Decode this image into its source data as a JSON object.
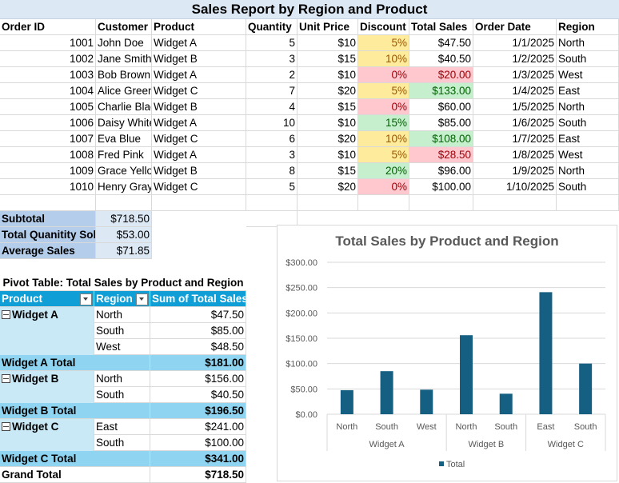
{
  "title": "Sales Report by Region and Product",
  "columns": [
    "Order ID",
    "Customer N",
    "Product",
    "Quantity",
    "Unit Price",
    "Discount",
    "Total Sales",
    "Order Date",
    "Region"
  ],
  "rows": [
    {
      "id": "1001",
      "customer": "John Doe",
      "product": "Widget A",
      "qty": "5",
      "price": "$10",
      "discount": "5%",
      "dclass": "yellow",
      "total": "$47.50",
      "tclass": "",
      "date": "1/1/2025",
      "region": "North"
    },
    {
      "id": "1002",
      "customer": "Jane Smith",
      "product": "Widget B",
      "qty": "3",
      "price": "$15",
      "discount": "10%",
      "dclass": "yellow",
      "total": "$40.50",
      "tclass": "",
      "date": "1/2/2025",
      "region": "South"
    },
    {
      "id": "1003",
      "customer": "Bob Brown",
      "product": "Widget A",
      "qty": "2",
      "price": "$10",
      "discount": "0%",
      "dclass": "red",
      "total": "$20.00",
      "tclass": "red",
      "date": "1/3/2025",
      "region": "West"
    },
    {
      "id": "1004",
      "customer": "Alice Green",
      "product": "Widget C",
      "qty": "7",
      "price": "$20",
      "discount": "5%",
      "dclass": "yellow",
      "total": "$133.00",
      "tclass": "green",
      "date": "1/4/2025",
      "region": "East"
    },
    {
      "id": "1005",
      "customer": "Charlie Blac",
      "product": "Widget B",
      "qty": "4",
      "price": "$15",
      "discount": "0%",
      "dclass": "red",
      "total": "$60.00",
      "tclass": "",
      "date": "1/5/2025",
      "region": "North"
    },
    {
      "id": "1006",
      "customer": "Daisy White",
      "product": "Widget A",
      "qty": "10",
      "price": "$10",
      "discount": "15%",
      "dclass": "green",
      "total": "$85.00",
      "tclass": "",
      "date": "1/6/2025",
      "region": "South"
    },
    {
      "id": "1007",
      "customer": "Eva Blue",
      "product": "Widget C",
      "qty": "6",
      "price": "$20",
      "discount": "10%",
      "dclass": "yellow",
      "total": "$108.00",
      "tclass": "green",
      "date": "1/7/2025",
      "region": "East"
    },
    {
      "id": "1008",
      "customer": "Fred Pink",
      "product": "Widget A",
      "qty": "3",
      "price": "$10",
      "discount": "5%",
      "dclass": "yellow",
      "total": "$28.50",
      "tclass": "red",
      "date": "1/8/2025",
      "region": "West"
    },
    {
      "id": "1009",
      "customer": "Grace Yello",
      "product": "Widget B",
      "qty": "8",
      "price": "$15",
      "discount": "20%",
      "dclass": "green",
      "total": "$96.00",
      "tclass": "",
      "date": "1/9/2025",
      "region": "North"
    },
    {
      "id": "1010",
      "customer": "Henry Gray",
      "product": "Widget C",
      "qty": "5",
      "price": "$20",
      "discount": "0%",
      "dclass": "red",
      "total": "$100.00",
      "tclass": "",
      "date": "1/10/2025",
      "region": "South"
    }
  ],
  "summary": [
    {
      "label": "Subtotal",
      "value": "$718.50"
    },
    {
      "label": "Total Quanitity Sold",
      "value": "$53.00"
    },
    {
      "label": "Average Sales",
      "value": "$71.85"
    }
  ],
  "pivot": {
    "title": "Pivot Table: Total Sales by Product and Region",
    "headers": [
      "Product",
      "Region",
      "Sum of Total Sales"
    ],
    "rows": [
      {
        "product": "Widget A",
        "region": "North",
        "value": "$47.50",
        "type": "first"
      },
      {
        "product": "",
        "region": "South",
        "value": "$85.00",
        "type": "item"
      },
      {
        "product": "",
        "region": "West",
        "value": "$48.50",
        "type": "item"
      },
      {
        "product": "Widget A Total",
        "region": "",
        "value": "$181.00",
        "type": "total"
      },
      {
        "product": "Widget B",
        "region": "North",
        "value": "$156.00",
        "type": "first"
      },
      {
        "product": "",
        "region": "South",
        "value": "$40.50",
        "type": "item"
      },
      {
        "product": "Widget B Total",
        "region": "",
        "value": "$196.50",
        "type": "total"
      },
      {
        "product": "Widget C",
        "region": "East",
        "value": "$241.00",
        "type": "first"
      },
      {
        "product": "",
        "region": "South",
        "value": "$100.00",
        "type": "item"
      },
      {
        "product": "Widget C Total",
        "region": "",
        "value": "$341.00",
        "type": "total"
      },
      {
        "product": "Grand Total",
        "region": "",
        "value": "$718.50",
        "type": "grand"
      }
    ]
  },
  "colors": {
    "bar": "#156082",
    "pivot_header": "#0f9ed5",
    "pivot_item": "#c9e9f6",
    "pivot_total": "#8fd4f0"
  },
  "chart_data": {
    "type": "bar",
    "title": "Total Sales by Product and Region",
    "categories": [
      [
        "North",
        "Widget A"
      ],
      [
        "South",
        "Widget A"
      ],
      [
        "West",
        "Widget A"
      ],
      [
        "North",
        "Widget B"
      ],
      [
        "South",
        "Widget B"
      ],
      [
        "East",
        "Widget C"
      ],
      [
        "South",
        "Widget C"
      ]
    ],
    "groups": [
      "Widget A",
      "Widget B",
      "Widget C"
    ],
    "series": [
      {
        "name": "Total",
        "values": [
          47.5,
          85,
          48.5,
          156,
          40.5,
          241,
          100
        ]
      }
    ],
    "yticks": [
      "$0.00",
      "$50.00",
      "$100.00",
      "$150.00",
      "$200.00",
      "$250.00",
      "$300.00"
    ],
    "ylim": [
      0,
      300
    ],
    "legend": "bottom"
  }
}
